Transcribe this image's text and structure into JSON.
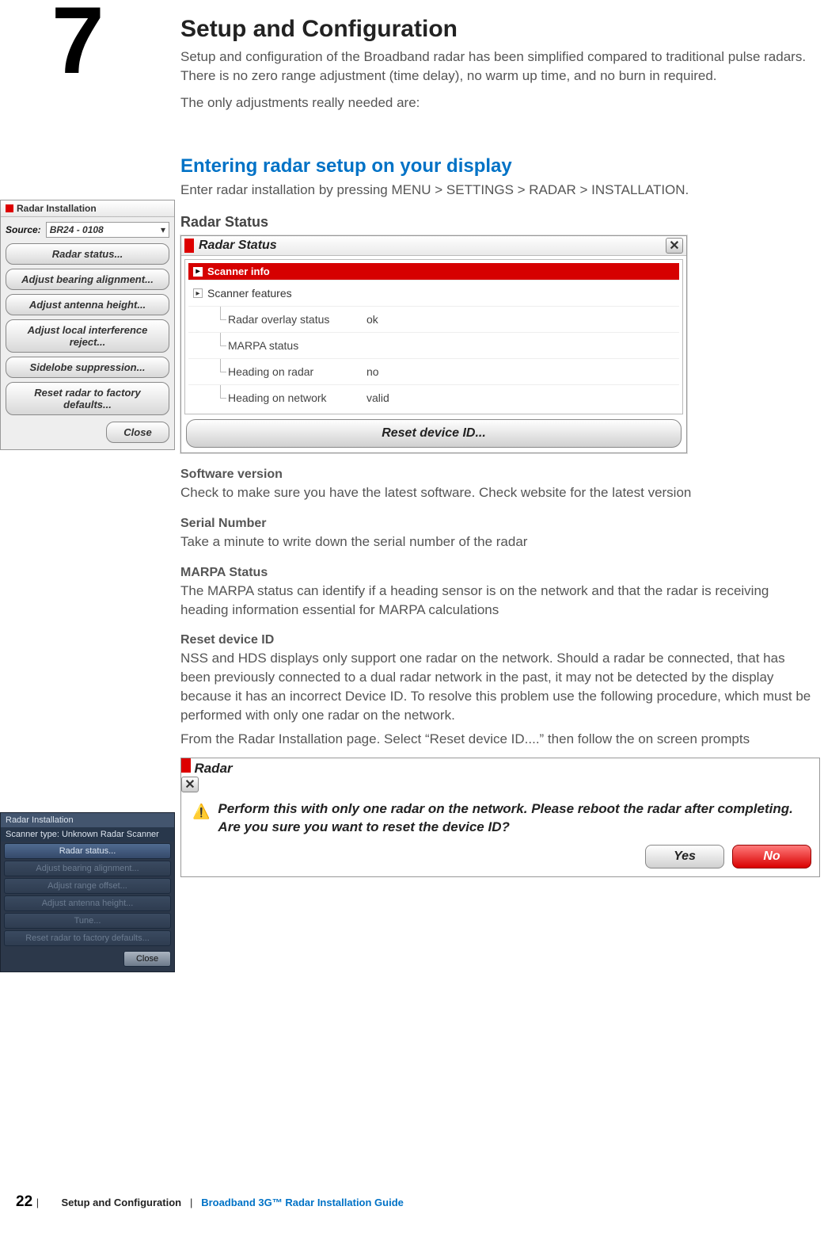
{
  "chapter_number": "7",
  "title": "Setup and Configuration",
  "intro_para": "Setup and configuration of the Broadband radar has been simplified compared to traditional pulse radars. There is no zero range adjustment (time delay), no warm up time, and no burn in required.",
  "intro_adjust": "The only adjustments really needed are:",
  "h2_entering": "Entering radar setup on your display",
  "entering_body": "Enter radar installation by pressing MENU > SETTINGS > RADAR > INSTALLATION.",
  "h3_status": "Radar Status",
  "install_dialog": {
    "title": "Radar Installation",
    "source_label": "Source:",
    "source_value": "BR24 - 0108",
    "buttons": [
      "Radar status...",
      "Adjust bearing alignment...",
      "Adjust antenna height...",
      "Adjust local interference reject...",
      "Sidelobe suppression...",
      "Reset radar to factory defaults..."
    ],
    "close": "Close"
  },
  "status_dialog": {
    "title": "Radar Status",
    "scanner_info": "Scanner info",
    "scanner_features": "Scanner features",
    "rows": [
      {
        "k": "Radar overlay status",
        "v": "ok"
      },
      {
        "k": "MARPA status",
        "v": ""
      },
      {
        "k": "Heading on radar",
        "v": "no"
      },
      {
        "k": "Heading on network",
        "v": "valid"
      }
    ],
    "reset_btn": "Reset device ID..."
  },
  "software_h": "Software version",
  "software_p": "Check to make sure you have the latest software. Check website for the latest version",
  "serial_h": "Serial Number",
  "serial_p": "Take a minute to write down the serial number of the radar",
  "marpa_h": "MARPA Status",
  "marpa_p": "The MARPA status can identify if a heading sensor is on the network and  that the radar is receiving heading information essential for MARPA calculations",
  "reset_h": "Reset device ID",
  "reset_p1": "NSS and HDS displays only support one radar on the network. Should a radar be connected, that has been previously connected to a dual radar network in the past, it may not be detected by the display because it has an incorrect Device ID. To resolve this problem use the following procedure, which must be performed with only one radar on the network.",
  "reset_p2": "From the Radar Installation page. Select “Reset device ID....” then follow the on screen prompts",
  "dark_dialog": {
    "title": "Radar Installation",
    "scanner_type_label": "Scanner type:",
    "scanner_type_value": "Unknown Radar Scanner",
    "buttons": [
      "Radar status...",
      "Adjust bearing alignment...",
      "Adjust range offset...",
      "Adjust antenna height...",
      "Tune...",
      "Reset radar to factory defaults..."
    ],
    "close": "Close"
  },
  "confirm_dialog": {
    "title": "Radar",
    "message": "Perform this with only one radar on the network.  Please reboot the radar after completing.  Are you sure you want to reset the device ID?",
    "yes": "Yes",
    "no": "No"
  },
  "footer": {
    "page": "22",
    "section": "Setup and Configuration",
    "guide": "Broadband 3G™ Radar  Installation Guide"
  }
}
